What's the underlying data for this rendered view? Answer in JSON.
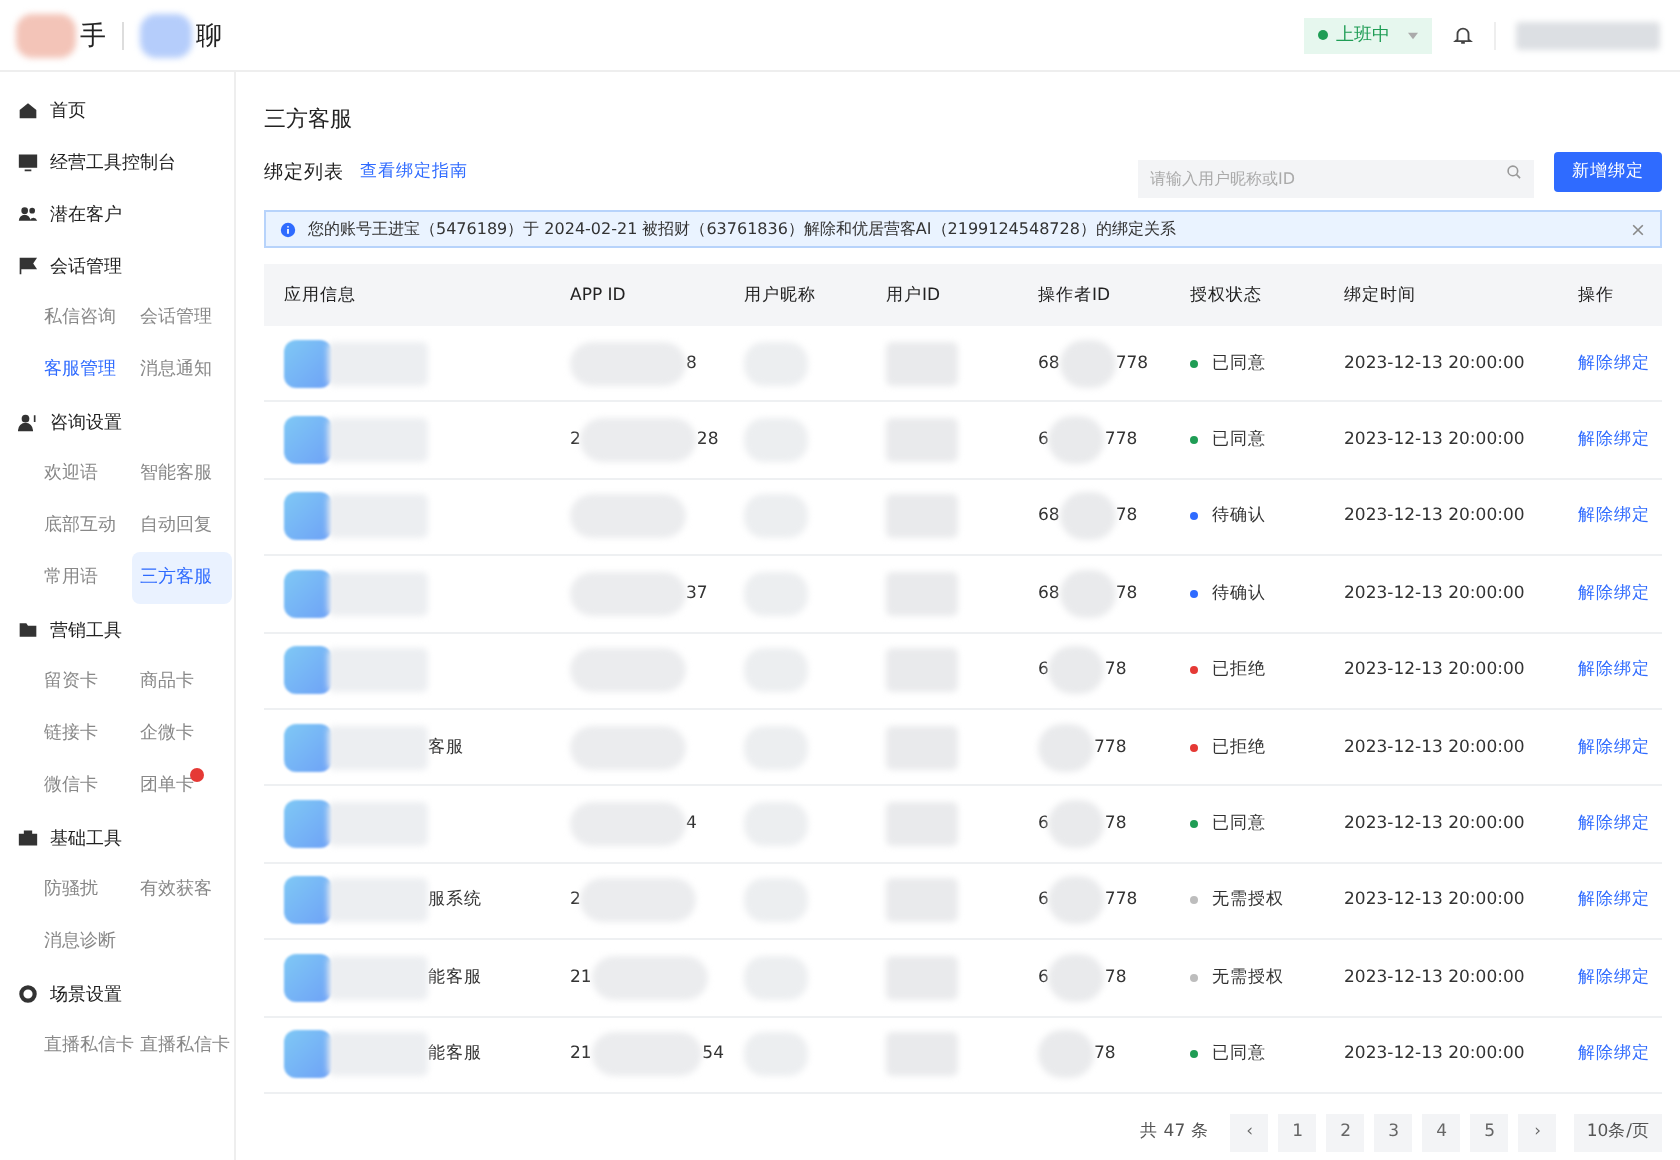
{
  "header": {
    "logo_left": "手",
    "logo_right": "聊",
    "status": {
      "label": "上班中",
      "on": true
    }
  },
  "sidebar": [
    {
      "label": "首页"
    },
    {
      "label": "经营工具控制台"
    },
    {
      "label": "潜在客户"
    },
    {
      "label": "会话管理",
      "children": [
        {
          "label": "私信咨询",
          "selected": false,
          "active": false
        },
        {
          "label": "会话管理",
          "selected": false,
          "active": false
        },
        {
          "label": "客服管理",
          "selected": false,
          "active": true
        },
        {
          "label": "消息通知",
          "selected": false,
          "active": false
        }
      ]
    },
    {
      "label": "咨询设置",
      "children": [
        {
          "label": "欢迎语",
          "selected": false,
          "active": false
        },
        {
          "label": "智能客服",
          "selected": false,
          "active": false
        },
        {
          "label": "底部互动",
          "selected": false,
          "active": false
        },
        {
          "label": "自动回复",
          "selected": false,
          "active": false
        },
        {
          "label": "常用语",
          "selected": false,
          "active": false
        },
        {
          "label": "三方客服",
          "selected": true,
          "active": false
        }
      ]
    },
    {
      "label": "营销工具",
      "children": [
        {
          "label": "留资卡",
          "selected": false,
          "active": false
        },
        {
          "label": "商品卡",
          "selected": false,
          "active": false
        },
        {
          "label": "链接卡",
          "selected": false,
          "active": false
        },
        {
          "label": "企微卡",
          "selected": false,
          "active": false
        },
        {
          "label": "微信卡",
          "selected": false,
          "active": false
        },
        {
          "label": "团单卡",
          "selected": false,
          "active": false,
          "badge": true
        }
      ]
    },
    {
      "label": "基础工具",
      "children": [
        {
          "label": "防骚扰",
          "selected": false,
          "active": false
        },
        {
          "label": "有效获客",
          "selected": false,
          "active": false
        },
        {
          "label": "消息诊断",
          "selected": false,
          "active": false
        }
      ]
    },
    {
      "label": "场景设置",
      "children": [
        {
          "label": "直播私信卡",
          "selected": false,
          "active": false
        },
        {
          "label": "直播私信卡",
          "selected": false,
          "active": false
        }
      ]
    }
  ],
  "page_title": "三方客服",
  "list_title": "绑定列表",
  "guide_link": "查看绑定指南",
  "search": {
    "placeholder": "请输入用户昵称或ID"
  },
  "add_button": "新增绑定",
  "notice": "您的账号王进宝（5476189）于 2024-02-21 被招财（63761836）解除和优居营客AI（2199124548728）的绑定关系",
  "table": {
    "columns": [
      "应用信息",
      "APP ID",
      "用户昵称",
      "用户ID",
      "操作者ID",
      "授权状态",
      "绑定时间",
      "操作"
    ],
    "rows": [
      {
        "app_id_end": "8",
        "op_start": "68",
        "op_end": "778",
        "status": "已同意",
        "color": "#1f9d55",
        "time": "2023-12-13 20:00:00",
        "action": "解除绑定"
      },
      {
        "app_id_start": "2",
        "app_id_end": "28",
        "op_start": "6",
        "op_end": "778",
        "status": "已同意",
        "color": "#1f9d55",
        "time": "2023-12-13 20:00:00",
        "action": "解除绑定"
      },
      {
        "op_start": "68",
        "op_end": "78",
        "status": "待确认",
        "color": "#2f6bff",
        "time": "2023-12-13 20:00:00",
        "action": "解除绑定"
      },
      {
        "app_id_end": "37",
        "op_start": "68",
        "op_end": "78",
        "status": "待确认",
        "color": "#2f6bff",
        "time": "2023-12-13 20:00:00",
        "action": "解除绑定"
      },
      {
        "op_start": "6",
        "op_end": "78",
        "status": "已拒绝",
        "color": "#e53935",
        "time": "2023-12-13 20:00:00",
        "action": "解除绑定"
      },
      {
        "app_name": "客服",
        "op_end": "778",
        "status": "已拒绝",
        "color": "#e53935",
        "time": "2023-12-13 20:00:00",
        "action": "解除绑定"
      },
      {
        "app_id_end": "4",
        "op_start": "6",
        "op_end": "78",
        "status": "已同意",
        "color": "#1f9d55",
        "time": "2023-12-13 20:00:00",
        "action": "解除绑定"
      },
      {
        "app_name": "服系统",
        "app_id_start": "2",
        "op_start": "6",
        "op_end": "778",
        "status": "无需授权",
        "color": "#bdbdbd",
        "time": "2023-12-13 20:00:00",
        "action": "解除绑定"
      },
      {
        "app_name": "能客服",
        "app_id_start": "21",
        "op_start": "6",
        "op_end": "78",
        "status": "无需授权",
        "color": "#bdbdbd",
        "time": "2023-12-13 20:00:00",
        "action": "解除绑定"
      },
      {
        "app_name": "能客服",
        "app_id_start": "21",
        "app_id_end": "54",
        "op_end": "78",
        "status": "已同意",
        "color": "#1f9d55",
        "time": "2023-12-13 20:00:00",
        "action": "解除绑定"
      }
    ]
  },
  "pagination": {
    "total": "共 47 条",
    "prev": "‹",
    "pages": [
      {
        "label": "1",
        "selected": false
      },
      {
        "label": "2",
        "selected": false
      },
      {
        "label": "3",
        "selected": false
      },
      {
        "label": "4",
        "selected": false
      },
      {
        "label": "5",
        "selected": false
      }
    ],
    "next": "›",
    "page_size": "10条/页"
  }
}
